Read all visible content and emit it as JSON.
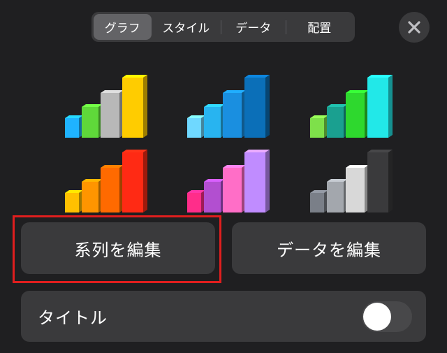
{
  "tabs": [
    {
      "label": "グラフ",
      "active": true
    },
    {
      "label": "スタイル",
      "active": false
    },
    {
      "label": "データ",
      "active": false
    },
    {
      "label": "配置",
      "active": false
    }
  ],
  "close_icon": "close-icon",
  "chart_styles": [
    {
      "name": "style-1",
      "colors": [
        "#1fb3ff",
        "#5fd83a",
        "#b8b8b8",
        "#ffcc00"
      ]
    },
    {
      "name": "style-2",
      "colors": [
        "#6fd8ff",
        "#28b4f0",
        "#1a8fe0",
        "#0b6fb8"
      ]
    },
    {
      "name": "style-3",
      "colors": [
        "#7ee04a",
        "#1aa090",
        "#2ed82e",
        "#22e8e8"
      ]
    },
    {
      "name": "style-4",
      "colors": [
        "#ffc000",
        "#ff9500",
        "#ff6a00",
        "#ff2a14"
      ]
    },
    {
      "name": "style-5",
      "colors": [
        "#ff2d8a",
        "#b24fd0",
        "#ff6ec7",
        "#c08cff"
      ]
    },
    {
      "name": "style-6",
      "colors": [
        "#7a7f88",
        "#a3a7ad",
        "#d8d8d8",
        "#3a3a3c"
      ]
    }
  ],
  "buttons": {
    "edit_series": "系列を編集",
    "edit_data": "データを編集"
  },
  "title_row": {
    "label": "タイトル",
    "toggle_on": false
  },
  "colors": {
    "background": "#1f1f21",
    "control": "#3a3a3c",
    "highlight": "#e01e1e"
  }
}
